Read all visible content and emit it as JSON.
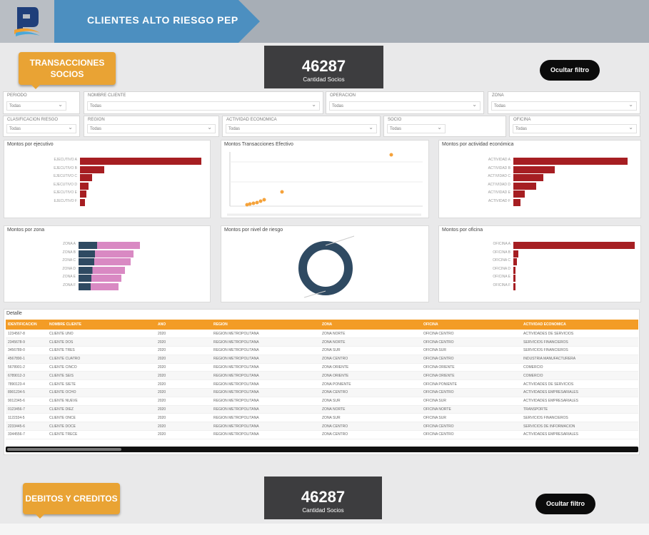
{
  "header": {
    "title": "CLIENTES ALTO RIESGO PEP",
    "logo_icon": "bank-logo-icon",
    "title_color": "#4c8fc0"
  },
  "section1": {
    "tag_label": "TRANSACCIONES SOCIOS",
    "kpi_value": "46287",
    "kpi_label": "Cantidad Socios",
    "menu_label": "Ocultar filtro"
  },
  "filters": [
    {
      "label": "PERIODO",
      "value": "Todas"
    },
    {
      "label": "NOMBRE CLIENTE",
      "value": "Todas"
    },
    {
      "label": "OPERACION",
      "value": "Todas"
    },
    {
      "label": "ZONA",
      "value": "Todas"
    },
    {
      "label": "CLASIFICACION RIESGO",
      "value": "Todas"
    },
    {
      "label": "REGION",
      "value": "Todas"
    },
    {
      "label": "ACTIVIDAD ECONOMICA",
      "value": "Todas"
    },
    {
      "label": "SOCIO",
      "value": "Todas"
    },
    {
      "label": "OFICINA",
      "value": "Todas"
    }
  ],
  "panels": {
    "p1_title": "Montos por ejecutivo",
    "p2_title": "Montos Transacciones Efectivo",
    "p3_title": "Montos por actividad económica",
    "p4_title": "Montos por zona",
    "p5_title": "Montos por nivel de riesgo",
    "p6_title": "Montos por oficina"
  },
  "p1": {
    "labels": [
      "EJECUTIVO A",
      "EJECUTIVO B",
      "EJECUTIVO C",
      "EJECUTIVO D",
      "EJECUTIVO E",
      "EJECUTIVO F"
    ],
    "values": [
      100,
      20,
      10,
      7,
      5,
      4
    ]
  },
  "p3": {
    "labels": [
      "ACTIVIDAD A",
      "ACTIVIDAD B",
      "ACTIVIDAD C",
      "ACTIVIDAD D",
      "ACTIVIDAD E",
      "ACTIVIDAD F"
    ],
    "values": [
      100,
      36,
      26,
      20,
      10,
      6
    ]
  },
  "p4": {
    "labels": [
      "ZONA A",
      "ZONA B",
      "ZONA C",
      "ZONA D",
      "ZONA E",
      "ZONA F"
    ],
    "values": [
      100,
      90,
      85,
      75,
      70,
      65
    ]
  },
  "p6": {
    "labels": [
      "OFICINA A",
      "OFICINA B",
      "OFICINA C",
      "OFICINA D",
      "OFICINA E",
      "OFICINA F"
    ],
    "values": [
      100,
      4,
      3,
      2,
      2,
      1
    ]
  },
  "table": {
    "title": "Detalle",
    "columns": [
      "IDENTIFICACION",
      "NOMBRE CLIENTE",
      "ANO",
      "REGION",
      "ZONA",
      "OFICINA",
      "ACTIVIDAD ECONOMICA"
    ],
    "rows": [
      [
        "1234567-8",
        "CLIENTE UNO",
        "2020",
        "REGION METROPOLITANA",
        "ZONA NORTE",
        "OFICINA CENTRO",
        "ACTIVIDADES DE SERVICIOS"
      ],
      [
        "2345678-9",
        "CLIENTE DOS",
        "2020",
        "REGION METROPOLITANA",
        "ZONA NORTE",
        "OFICINA CENTRO",
        "SERVICIOS FINANCIEROS"
      ],
      [
        "3456789-0",
        "CLIENTE TRES",
        "2020",
        "REGION METROPOLITANA",
        "ZONA SUR",
        "OFICINA SUR",
        "SERVICIOS FINANCIEROS"
      ],
      [
        "4567890-1",
        "CLIENTE CUATRO",
        "2020",
        "REGION METROPOLITANA",
        "ZONA CENTRO",
        "OFICINA CENTRO",
        "INDUSTRIA MANUFACTURERA"
      ],
      [
        "5678901-2",
        "CLIENTE CINCO",
        "2020",
        "REGION METROPOLITANA",
        "ZONA ORIENTE",
        "OFICINA ORIENTE",
        "COMERCIO"
      ],
      [
        "6789012-3",
        "CLIENTE SEIS",
        "2020",
        "REGION METROPOLITANA",
        "ZONA ORIENTE",
        "OFICINA ORIENTE",
        "COMERCIO"
      ],
      [
        "7890123-4",
        "CLIENTE SIETE",
        "2020",
        "REGION METROPOLITANA",
        "ZONA PONIENTE",
        "OFICINA PONIENTE",
        "ACTIVIDADES DE SERVICIOS"
      ],
      [
        "8901234-5",
        "CLIENTE OCHO",
        "2020",
        "REGION METROPOLITANA",
        "ZONA CENTRO",
        "OFICINA CENTRO",
        "ACTIVIDADES EMPRESARIALES"
      ],
      [
        "9012345-6",
        "CLIENTE NUEVE",
        "2020",
        "REGION METROPOLITANA",
        "ZONA SUR",
        "OFICINA SUR",
        "ACTIVIDADES EMPRESARIALES"
      ],
      [
        "0123456-7",
        "CLIENTE DIEZ",
        "2020",
        "REGION METROPOLITANA",
        "ZONA NORTE",
        "OFICINA NORTE",
        "TRANSPORTE"
      ],
      [
        "1122334-5",
        "CLIENTE ONCE",
        "2020",
        "REGION METROPOLITANA",
        "ZONA SUR",
        "OFICINA SUR",
        "SERVICIOS FINANCIEROS"
      ],
      [
        "2233445-6",
        "CLIENTE DOCE",
        "2020",
        "REGION METROPOLITANA",
        "ZONA CENTRO",
        "OFICINA CENTRO",
        "SERVICIOS DE INFORMACION"
      ],
      [
        "3344556-7",
        "CLIENTE TRECE",
        "2020",
        "REGION METROPOLITANA",
        "ZONA CENTRO",
        "OFICINA CENTRO",
        "ACTIVIDADES EMPRESARIALES"
      ]
    ]
  },
  "section2": {
    "tag_label": "DEBITOS Y CREDITOS",
    "kpi_value": "46287",
    "kpi_label": "Cantidad Socios",
    "menu_label": "Ocultar filtro"
  },
  "colors": {
    "accent_orange": "#f39c26",
    "bar_red": "#a61e22",
    "kpi_dark": "#3d3d3f",
    "donut_navy": "#2f4a62",
    "zona_pink": "#d989c3"
  }
}
